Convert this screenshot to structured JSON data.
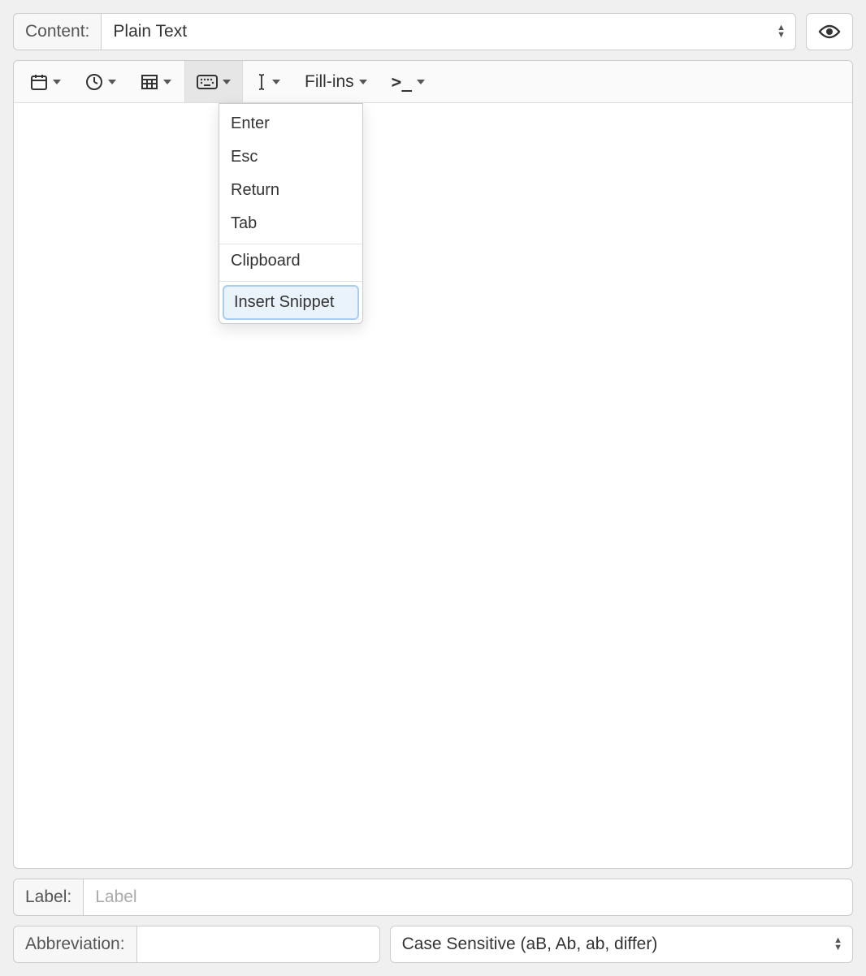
{
  "header": {
    "content_label": "Content:",
    "content_type": "Plain Text"
  },
  "toolbar": {
    "fillins_label": "Fill-ins",
    "script_symbol": ">_"
  },
  "dropdown": {
    "items": [
      "Enter",
      "Esc",
      "Return",
      "Tab"
    ],
    "items2": [
      "Clipboard"
    ],
    "highlighted": "Insert Snippet"
  },
  "footer": {
    "label_field_label": "Label:",
    "label_placeholder": "Label",
    "abbr_label": "Abbreviation:",
    "abbr_value": "",
    "case_option": "Case Sensitive (aB, Ab, ab, differ)"
  }
}
